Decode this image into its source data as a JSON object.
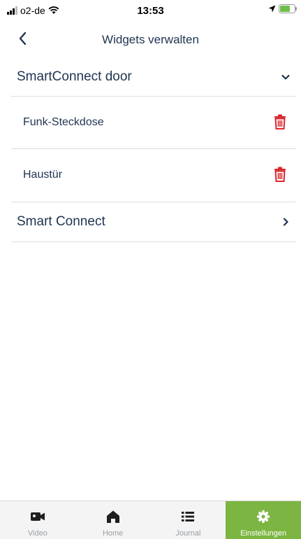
{
  "status_bar": {
    "carrier": "o2-de",
    "time": "13:53"
  },
  "header": {
    "title": "Widgets verwalten",
    "back_icon": "chevron-left-icon"
  },
  "groups": [
    {
      "label": "SmartConnect door",
      "state": "expanded",
      "items": [
        {
          "label": "Funk-Steckdose",
          "action_icon": "trash-icon"
        },
        {
          "label": "Haustür",
          "action_icon": "trash-icon"
        }
      ]
    },
    {
      "label": "Smart Connect",
      "state": "collapsed"
    }
  ],
  "tab_bar": {
    "tabs": [
      {
        "label": "Video",
        "icon": "video-camera-icon"
      },
      {
        "label": "Home",
        "icon": "home-icon"
      },
      {
        "label": "Journal",
        "icon": "list-icon"
      },
      {
        "label": "Einstellungen",
        "icon": "gear-icon",
        "active": true
      }
    ]
  },
  "colors": {
    "accent": "#7cb542",
    "delete": "#d9262e",
    "text": "#1f3350",
    "tab_inactive": "#9aa0a6"
  }
}
